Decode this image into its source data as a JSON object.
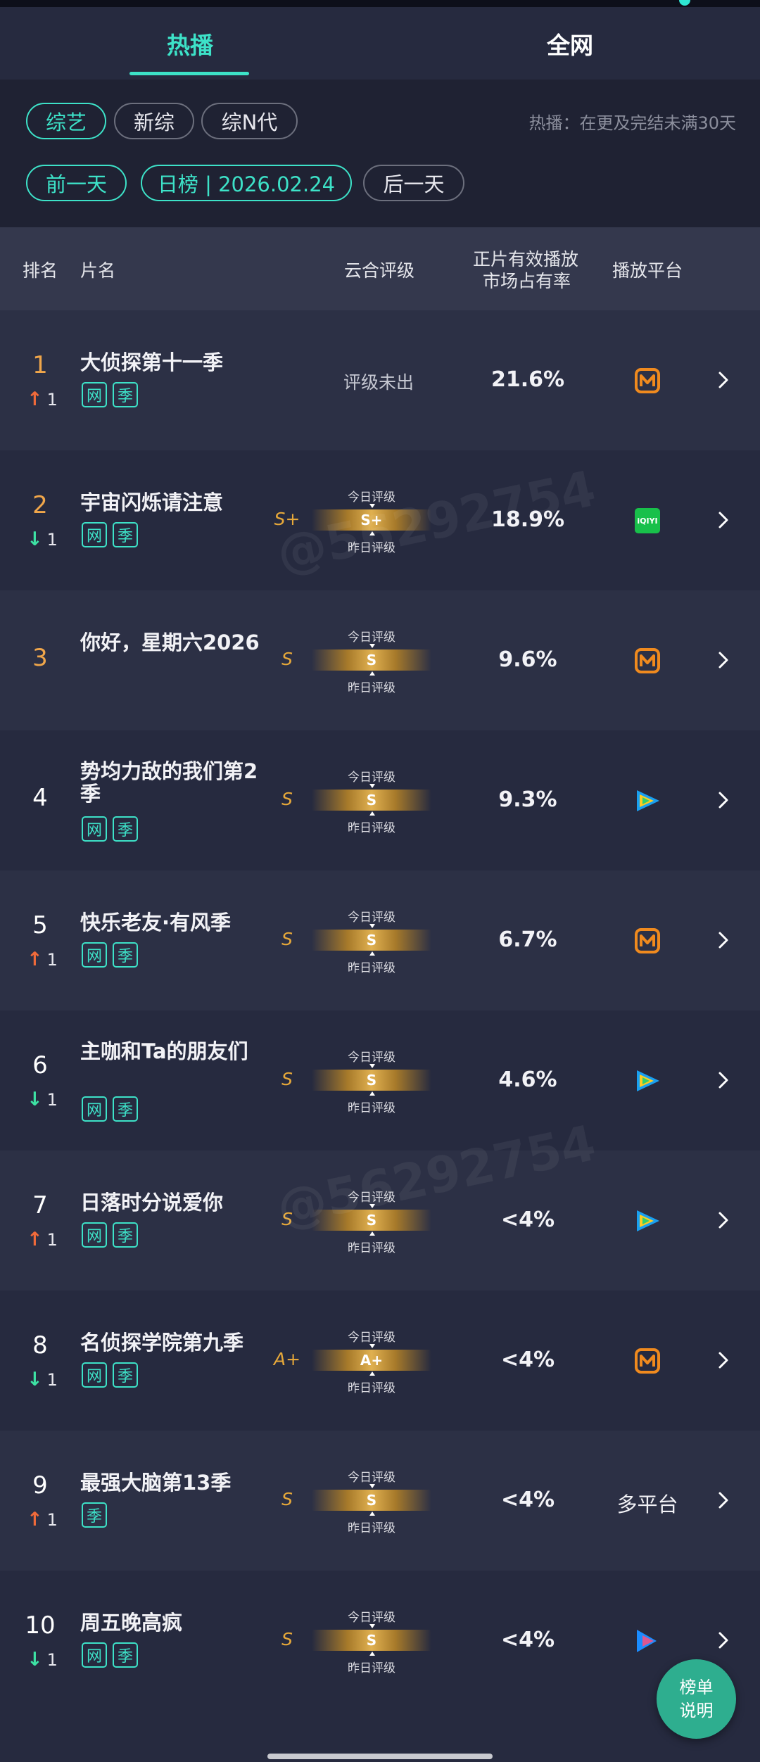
{
  "tabs": {
    "hot": "热播",
    "all": "全网"
  },
  "filters": {
    "categories": [
      "综艺",
      "新综",
      "综N代"
    ],
    "note": "热播：在更及完结未满30天",
    "prev": "前一天",
    "date": "日榜 | 2026.02.24",
    "next": "后一天"
  },
  "headers": {
    "rank": "排名",
    "title": "片名",
    "grade": "云合评级",
    "share_line1": "正片有效播放",
    "share_line2": "市场占有率",
    "platform": "播放平台"
  },
  "grade_labels": {
    "today": "今日评级",
    "yesterday": "昨日评级"
  },
  "rows": [
    {
      "rank": "1",
      "change_dir": "up",
      "change": "1",
      "title": "大侦探第十一季",
      "badges": [
        "网",
        "季"
      ],
      "grade_status": "评级未出",
      "share": "21.6%",
      "platform": "mgtv"
    },
    {
      "rank": "2",
      "change_dir": "down",
      "change": "1",
      "title": "宇宙闪烁请注意",
      "badges": [
        "网",
        "季"
      ],
      "grade": "S+",
      "today": "S+",
      "share": "18.9%",
      "platform": "iqiyi",
      "platform_label": "iQIYI"
    },
    {
      "rank": "3",
      "change_dir": "",
      "change": "",
      "title": "你好，星期六2026",
      "badges": [],
      "grade": "S",
      "today": "S",
      "share": "9.6%",
      "platform": "mgtv"
    },
    {
      "rank": "4",
      "change_dir": "",
      "change": "",
      "title": "势均力敌的我们第2季",
      "badges": [
        "网",
        "季"
      ],
      "grade": "S",
      "today": "S",
      "share": "9.3%",
      "platform": "tencent"
    },
    {
      "rank": "5",
      "change_dir": "up",
      "change": "1",
      "title": "快乐老友·有风季",
      "badges": [
        "网",
        "季"
      ],
      "grade": "S",
      "today": "S",
      "share": "6.7%",
      "platform": "mgtv"
    },
    {
      "rank": "6",
      "change_dir": "down",
      "change": "1",
      "title": "主咖和Ta的朋友们",
      "badges": [
        "网",
        "季"
      ],
      "grade": "S",
      "today": "S",
      "share": "4.6%",
      "platform": "tencent"
    },
    {
      "rank": "7",
      "change_dir": "up",
      "change": "1",
      "title": "日落时分说爱你",
      "badges": [
        "网",
        "季"
      ],
      "grade": "S",
      "today": "S",
      "share": "<4%",
      "platform": "tencent"
    },
    {
      "rank": "8",
      "change_dir": "down",
      "change": "1",
      "title": "名侦探学院第九季",
      "badges": [
        "网",
        "季"
      ],
      "grade": "A+",
      "today": "A+",
      "share": "<4%",
      "platform": "mgtv"
    },
    {
      "rank": "9",
      "change_dir": "up",
      "change": "1",
      "title": "最强大脑第13季",
      "badges": [
        "季"
      ],
      "grade": "S",
      "today": "S",
      "share": "<4%",
      "platform": "multi",
      "platform_text": "多平台"
    },
    {
      "rank": "10",
      "change_dir": "down",
      "change": "1",
      "title": "周五晚高疯",
      "badges": [
        "网",
        "季"
      ],
      "grade": "S",
      "today": "S",
      "share": "<4%",
      "platform": "youku"
    }
  ],
  "fab_label_1": "榜单",
  "fab_label_2": "说明",
  "colors": {
    "accent": "#3de2c8",
    "up": "#f06a3a",
    "down": "#3de2a4",
    "rank_top": "#f0a64a",
    "grade": "#e6a83a",
    "mgtv": "#f08a1e",
    "iqiyi": "#18c04a"
  }
}
